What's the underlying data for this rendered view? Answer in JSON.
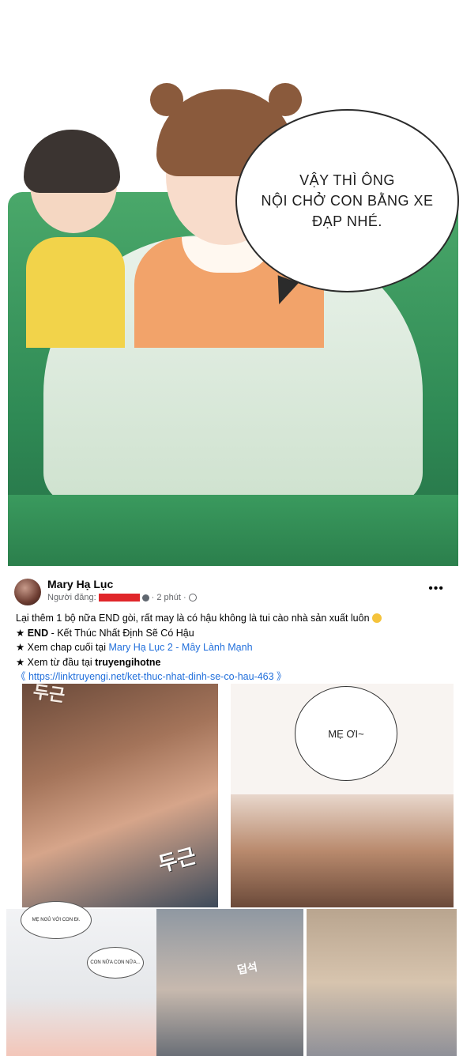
{
  "comic_top": {
    "bubble_lines": [
      "VẬY THÌ ÔNG",
      "NỘI CHỞ CON BẰNG XE",
      "ĐẠP NHÉ."
    ]
  },
  "post": {
    "author": "Mary Hạ Lục",
    "poster_label": "Người đăng:",
    "time": "2 phút",
    "separator": "·",
    "more": "•••",
    "line1": "Lại thêm 1 bộ nữa END gòi, rất may là có hậu không là tui cào nhà sản xuất luôn",
    "line2_star": "★",
    "line2_bold": "END",
    "line2_rest": " - Kết Thúc Nhất Định Sẽ Có Hậu",
    "line3_prefix": "★ Xem chap cuối tại ",
    "line3_link": "Mary Hạ Lục 2 - Mây Lành Mạnh",
    "line4_prefix": "★ Xem từ đầu tại ",
    "line4_bold": "truyengihotne",
    "line5_open": "《 ",
    "line5_link": "https://linktruyengi.net/ket-thuc-nhat-dinh-se-co-hau-463",
    "line5_close": " 》"
  },
  "comic_mid": {
    "bubble": "MẸ ƠI~",
    "sfx_top": "두근",
    "sfx_bottom": "두근"
  },
  "comic_bottom": {
    "bubble1": "MẸ NGỦ VỚI CON ĐI.",
    "bubble2": "CON NỮA CON NỮA...",
    "sfx": "덥석"
  }
}
